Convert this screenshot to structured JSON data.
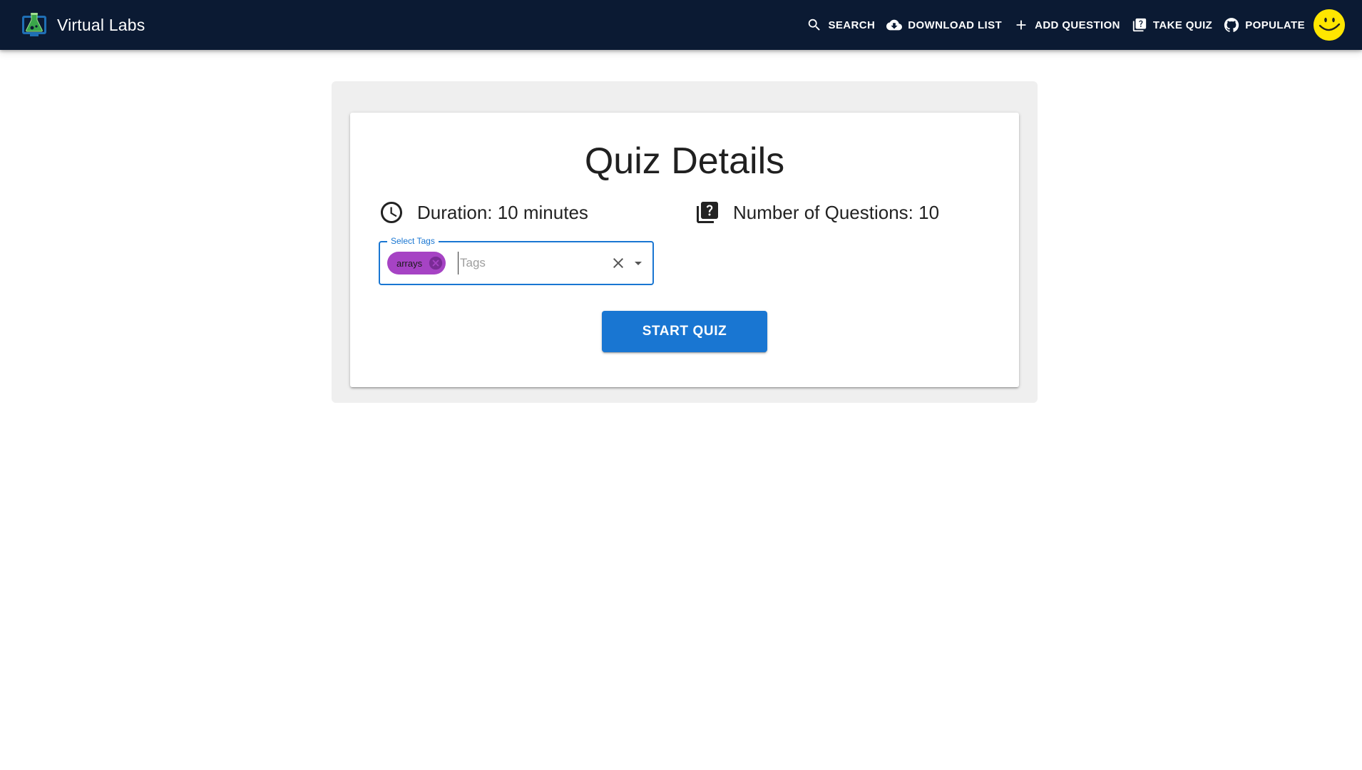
{
  "app": {
    "title": "Virtual Labs",
    "logo_icon": "flask-monitor-icon"
  },
  "nav": {
    "items": [
      {
        "label": "SEARCH",
        "icon": "search-icon"
      },
      {
        "label": "DOWNLOAD LIST",
        "icon": "cloud-download-icon"
      },
      {
        "label": "ADD QUESTION",
        "icon": "plus-icon"
      },
      {
        "label": "TAKE QUIZ",
        "icon": "quiz-icon"
      },
      {
        "label": "POPULATE",
        "icon": "github-icon"
      }
    ],
    "avatar_icon": "smiley-face-icon"
  },
  "quiz": {
    "title": "Quiz Details",
    "duration_text": "Duration: 10 minutes",
    "questions_text": "Number of Questions: 10",
    "duration_icon": "clock-icon",
    "questions_icon": "quiz-icon"
  },
  "tags": {
    "label": "Select Tags",
    "placeholder": "Tags",
    "selected": [
      "arrays"
    ]
  },
  "actions": {
    "start_label": "START QUIZ"
  },
  "colors": {
    "appbar": "#0b1a33",
    "primary": "#1976d2",
    "chip": "#a643c4",
    "avatar": "#ffe600",
    "panel": "#efefef"
  }
}
